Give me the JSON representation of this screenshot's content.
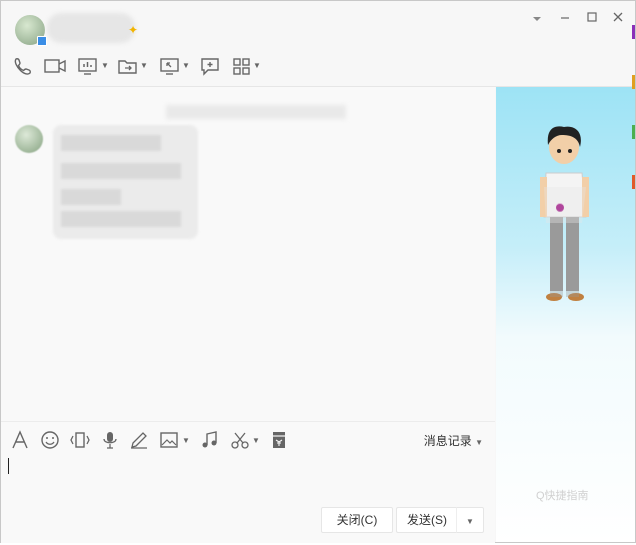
{
  "window_controls": {
    "dropdown_icon": "chevron-down-icon",
    "minimize_icon": "minimize-icon",
    "maximize_icon": "maximize-icon",
    "close_icon": "close-icon"
  },
  "toolbar": {
    "items": [
      "phone-icon",
      "video-icon",
      "screen-share-icon",
      "file-transfer-icon",
      "remote-desktop-icon",
      "add-chat-icon",
      "apps-grid-icon"
    ]
  },
  "input_toolbar": {
    "items": [
      "font-icon",
      "emoji-icon",
      "shake-icon",
      "voice-icon",
      "handwriting-icon",
      "image-icon",
      "music-icon",
      "screenshot-icon",
      "red-packet-icon"
    ],
    "history_label": "消息记录"
  },
  "buttons": {
    "close_label": "关闭(C)",
    "send_label": "发送(S)"
  },
  "watermark": "Q快捷指南",
  "colors": {
    "accent": "#3a8ee6",
    "side_panel_top": "#9de3f5",
    "window_bg": "#f7f7f7"
  }
}
